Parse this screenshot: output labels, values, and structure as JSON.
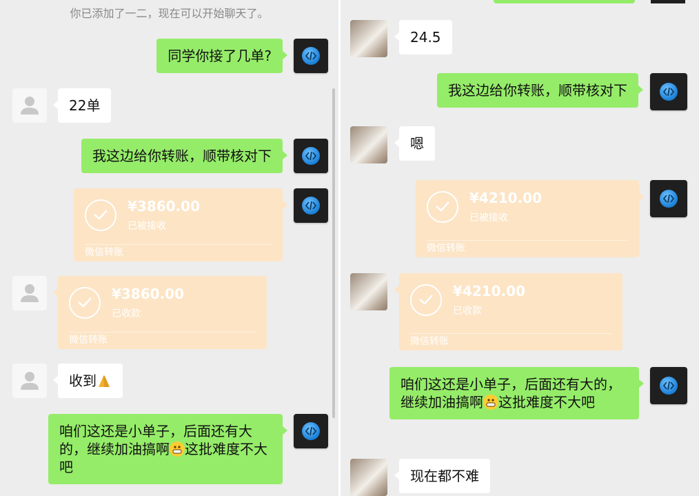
{
  "left": {
    "system_message": "你已添加了一二，现在可以开始聊天了。",
    "messages": [
      {
        "text": "同学你接了几单?"
      },
      {
        "text": "22单"
      },
      {
        "text": "我这边给你转账，顺带核对下"
      },
      {
        "amount": "¥3860.00",
        "status": "已被接收",
        "label": "微信转账"
      },
      {
        "amount": "¥3860.00",
        "status": "已收款",
        "label": "微信转账"
      },
      {
        "text": "收到"
      },
      {
        "text": "咱们这还是小单子，后面还有大的，继续加油搞啊",
        "text2": "这批难度不大吧"
      }
    ]
  },
  "right": {
    "messages": [
      {
        "text": "24.5"
      },
      {
        "text": "我这边给你转账，顺带核对下"
      },
      {
        "text": "嗯"
      },
      {
        "amount": "¥4210.00",
        "status": "已被接收",
        "label": "微信转账"
      },
      {
        "amount": "¥4210.00",
        "status": "已收款",
        "label": "微信转账"
      },
      {
        "text": "咱们这还是小单子，后面还有大的，继续加油搞啊",
        "text2": "这批难度不大吧"
      },
      {
        "text": "现在都不难"
      }
    ]
  },
  "icons": {
    "my_avatar": "code-brackets-logo-icon",
    "default_avatar": "person-silhouette-icon",
    "transfer_check": "checkmark-circle-icon",
    "emoji_pray": "folded-hands-emoji-icon",
    "emoji_grin": "grinning-face-emoji-icon"
  },
  "colors": {
    "outgoing_bubble": "#95ec69",
    "incoming_bubble": "#ffffff",
    "transfer_bubble": "#fce4c5",
    "chat_background": "#ededed"
  }
}
